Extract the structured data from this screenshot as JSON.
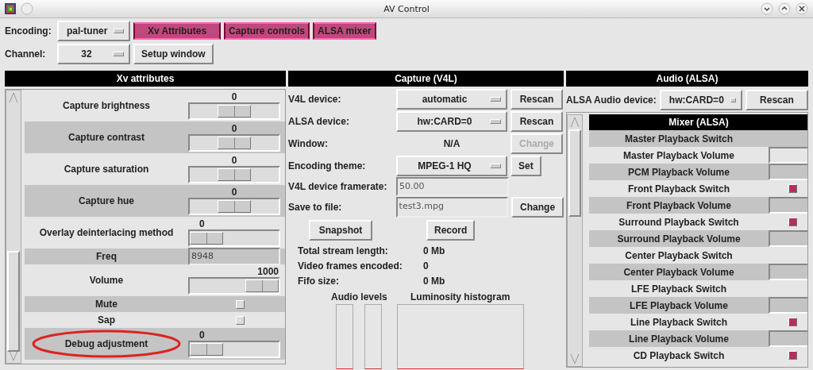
{
  "window": {
    "title": "AV Control"
  },
  "toolbar": {
    "encoding_label": "Encoding:",
    "encoding": "pal-tuner",
    "channel_label": "Channel:",
    "channel": "32",
    "setup_button": "Setup window",
    "toggles": [
      {
        "label": "Xv Attributes",
        "on": true
      },
      {
        "label": "Capture controls",
        "on": true
      },
      {
        "label": "ALSA mixer",
        "on": true
      }
    ]
  },
  "xv": {
    "title": "Xv attributes",
    "rows": [
      {
        "kind": "slider",
        "label": "Capture brightness",
        "value": "0",
        "level": 0.5
      },
      {
        "kind": "slider",
        "label": "Capture contrast",
        "value": "0",
        "level": 0.5
      },
      {
        "kind": "slider",
        "label": "Capture saturation",
        "value": "0",
        "level": 0.5
      },
      {
        "kind": "slider",
        "label": "Capture hue",
        "value": "0",
        "level": 0.5
      },
      {
        "kind": "slider",
        "label": "Overlay deinterlacing method",
        "value": "0",
        "level": 0
      },
      {
        "kind": "entry",
        "label": "Freq",
        "value": "8948"
      },
      {
        "kind": "slider",
        "label": "Volume",
        "value": "1000",
        "level": 1
      },
      {
        "kind": "checkbox",
        "label": "Mute",
        "checked": false
      },
      {
        "kind": "checkbox",
        "label": "Sap",
        "checked": false
      },
      {
        "kind": "slider",
        "label": "Debug adjustment",
        "value": "0",
        "level": 0,
        "circled": true
      }
    ]
  },
  "capture": {
    "title": "Capture (V4L)",
    "v4l_label": "V4L device:",
    "v4l_device": "automatic",
    "v4l_rescan": "Rescan",
    "alsa_label": "ALSA device:",
    "alsa_device": "hw:CARD=0",
    "alsa_rescan": "Rescan",
    "window_label": "Window:",
    "window_value": "N/A",
    "window_change": {
      "label": "Change",
      "disabled": true
    },
    "theme_label": "Encoding theme:",
    "theme": "MPEG-1 HQ",
    "theme_set": "Set",
    "framerate_label": "V4L device framerate:",
    "framerate": "50.00",
    "file_label": "Save to file:",
    "file": "test3.mpg",
    "file_change": {
      "label": "Change",
      "disabled": false
    },
    "snapshot": "Snapshot",
    "record": "Record",
    "stats": [
      {
        "label": "Total stream length:",
        "value": "0 Mb"
      },
      {
        "label": "Video frames encoded:",
        "value": "0"
      },
      {
        "label": "Fifo size:",
        "value": "0 Mb"
      }
    ],
    "audio_levels_label": "Audio levels",
    "histogram_label": "Luminosity histogram"
  },
  "audio": {
    "title": "Audio (ALSA)",
    "device_label": "ALSA Audio device:",
    "device": "hw:CARD=0",
    "rescan": "Rescan",
    "mixer_title": "Mixer (ALSA)",
    "controls": [
      {
        "kind": "switch",
        "label": "Master Playback Switch",
        "checked": false
      },
      {
        "kind": "volume",
        "label": "Master Playback Volume"
      },
      {
        "kind": "volume",
        "label": "PCM Playback Volume"
      },
      {
        "kind": "switch",
        "label": "Front Playback Switch",
        "checked": true
      },
      {
        "kind": "volume",
        "label": "Front Playback Volume"
      },
      {
        "kind": "switch",
        "label": "Surround Playback Switch",
        "checked": true
      },
      {
        "kind": "volume",
        "label": "Surround Playback Volume"
      },
      {
        "kind": "switch",
        "label": "Center Playback Switch",
        "checked": false
      },
      {
        "kind": "volume",
        "label": "Center Playback Volume"
      },
      {
        "kind": "switch",
        "label": "LFE Playback Switch",
        "checked": false
      },
      {
        "kind": "volume",
        "label": "LFE Playback Volume"
      },
      {
        "kind": "switch",
        "label": "Line Playback Switch",
        "checked": true
      },
      {
        "kind": "volume",
        "label": "Line Playback Volume"
      },
      {
        "kind": "switch",
        "label": "CD Playback Switch",
        "checked": true
      }
    ]
  }
}
